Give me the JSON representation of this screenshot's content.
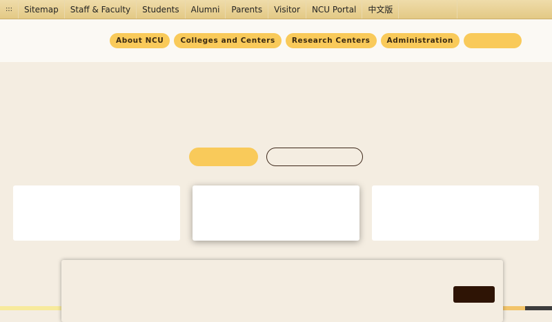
{
  "topbar": {
    "access_key": ":::",
    "items": [
      "Sitemap",
      "Staff & Faculty",
      "Students",
      "Alumni",
      "Parents",
      "Visitor",
      "NCU Portal",
      "中文版"
    ]
  },
  "mainnav": {
    "items": [
      "About NCU",
      "Colleges and Centers",
      "Research Centers",
      "Administration"
    ],
    "last_item": ""
  },
  "colors": {
    "accent_yellow": "#f9ca5a",
    "page_background": "#f4ede1",
    "dark_brown": "#2e1405"
  }
}
